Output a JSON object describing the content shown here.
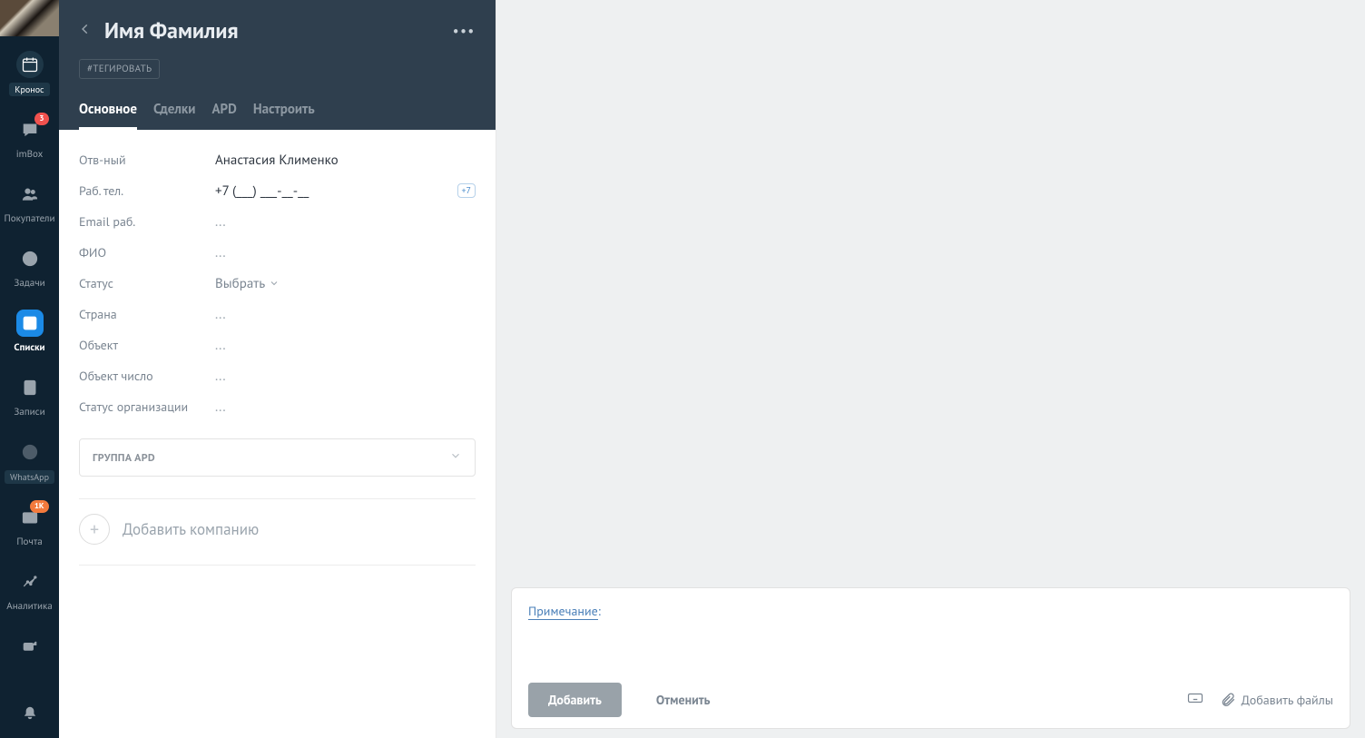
{
  "nav": {
    "items": [
      {
        "id": "kronos",
        "label": "Кронос",
        "icon": "calendar",
        "kind": "chip",
        "active": true
      },
      {
        "id": "imbox",
        "label": "imBox",
        "icon": "chat",
        "badge": "3",
        "badgeColor": "red"
      },
      {
        "id": "buyers",
        "label": "Покупатели",
        "icon": "users"
      },
      {
        "id": "tasks",
        "label": "Задачи",
        "icon": "check"
      },
      {
        "id": "lists",
        "label": "Списки",
        "icon": "list",
        "kind": "blue",
        "active": true
      },
      {
        "id": "records",
        "label": "Записи",
        "icon": "doc"
      },
      {
        "id": "whatsapp",
        "label": "WhatsApp",
        "icon": "whatsapp",
        "kind": "chip ghost"
      },
      {
        "id": "mail",
        "label": "Почта",
        "icon": "mail",
        "badge": "1K",
        "badgeColor": "orange"
      },
      {
        "id": "analytics",
        "label": "Аналитика",
        "icon": "analytics"
      },
      {
        "id": "retarget",
        "label": "",
        "icon": "retarget"
      },
      {
        "id": "bell",
        "label": "",
        "icon": "bell"
      }
    ]
  },
  "detail": {
    "title": "Имя Фамилия",
    "tag_button": "#ТЕГИРОВАТЬ",
    "tabs": [
      {
        "id": "main",
        "label": "Основное",
        "active": true
      },
      {
        "id": "deals",
        "label": "Сделки"
      },
      {
        "id": "apd",
        "label": "APD"
      },
      {
        "id": "settings",
        "label": "Настроить"
      }
    ],
    "fields": {
      "responsible_label": "Отв-ный",
      "responsible_value": "Анастасия Клименко",
      "work_phone_label": "Раб. тел.",
      "work_phone_value": "+7 (___) ___-__-__",
      "phone_badge": "+7",
      "work_email_label": "Email раб.",
      "work_email_value": "...",
      "fio_label": "ФИО",
      "fio_value": "...",
      "status_label": "Статус",
      "status_placeholder": "Выбрать",
      "country_label": "Страна",
      "country_value": "...",
      "object_label": "Объект",
      "object_value": "...",
      "object_num_label": "Объект число",
      "object_num_value": "...",
      "org_status_label": "Статус организации",
      "org_status_value": "..."
    },
    "group_label": "ГРУППА APD",
    "add_company": "Добавить компанию"
  },
  "note": {
    "label_link": "Примечание",
    "label_suffix": ":",
    "add_button": "Добавить",
    "cancel_button": "Отменить",
    "attach_label": "Добавить файлы"
  }
}
